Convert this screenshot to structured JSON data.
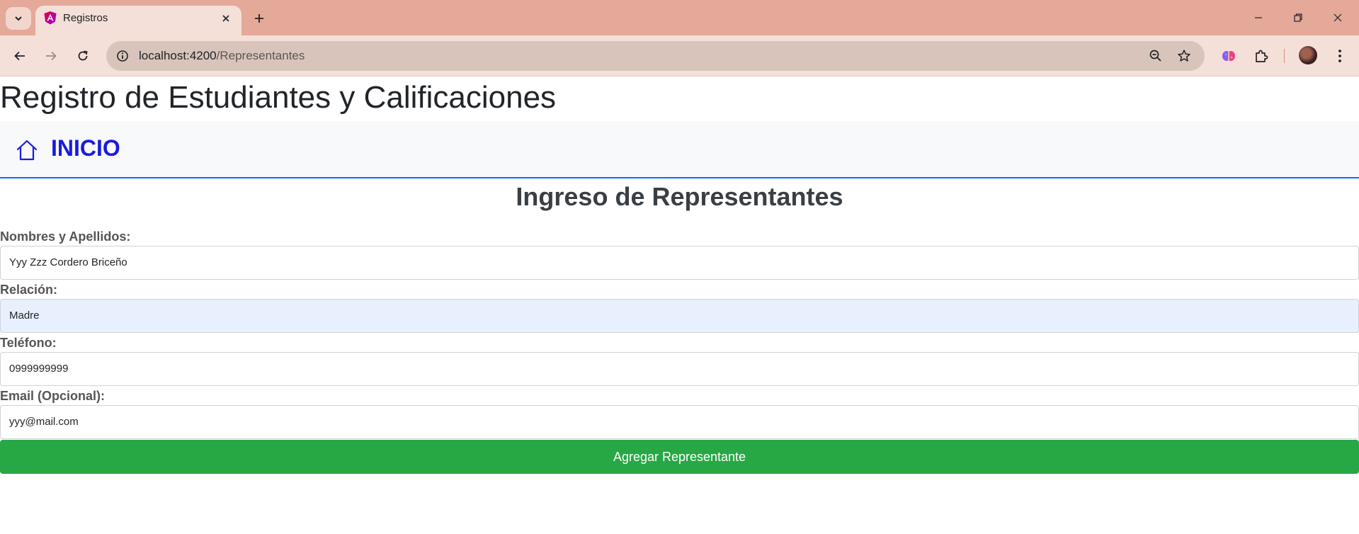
{
  "browser": {
    "tab": {
      "title": "Registros",
      "favicon": "angular-icon"
    },
    "url": {
      "host": "localhost:4200",
      "path": "/Representantes"
    },
    "colors": {
      "frame": "#e4a999",
      "toolbar": "#f5dfd9",
      "omnibox": "#d9c4bc"
    }
  },
  "app": {
    "title": "Registro de Estudiantes y Calificaciones",
    "nav": {
      "home_label": "INICIO",
      "home_icon": "house-icon",
      "accent": "#1a1ae0"
    }
  },
  "form": {
    "title": "Ingreso de Representantes",
    "fields": [
      {
        "label": "Nombres y Apellidos:",
        "value": "Yyy Zzz Cordero Briceño"
      },
      {
        "label": "Relación:",
        "value": "Madre"
      },
      {
        "label": "Teléfono:",
        "value": "0999999999"
      },
      {
        "label": "Email (Opcional):",
        "value": "yyy@mail.com"
      }
    ],
    "submit_label": "Agregar Representante",
    "submit_color": "#28a745"
  }
}
